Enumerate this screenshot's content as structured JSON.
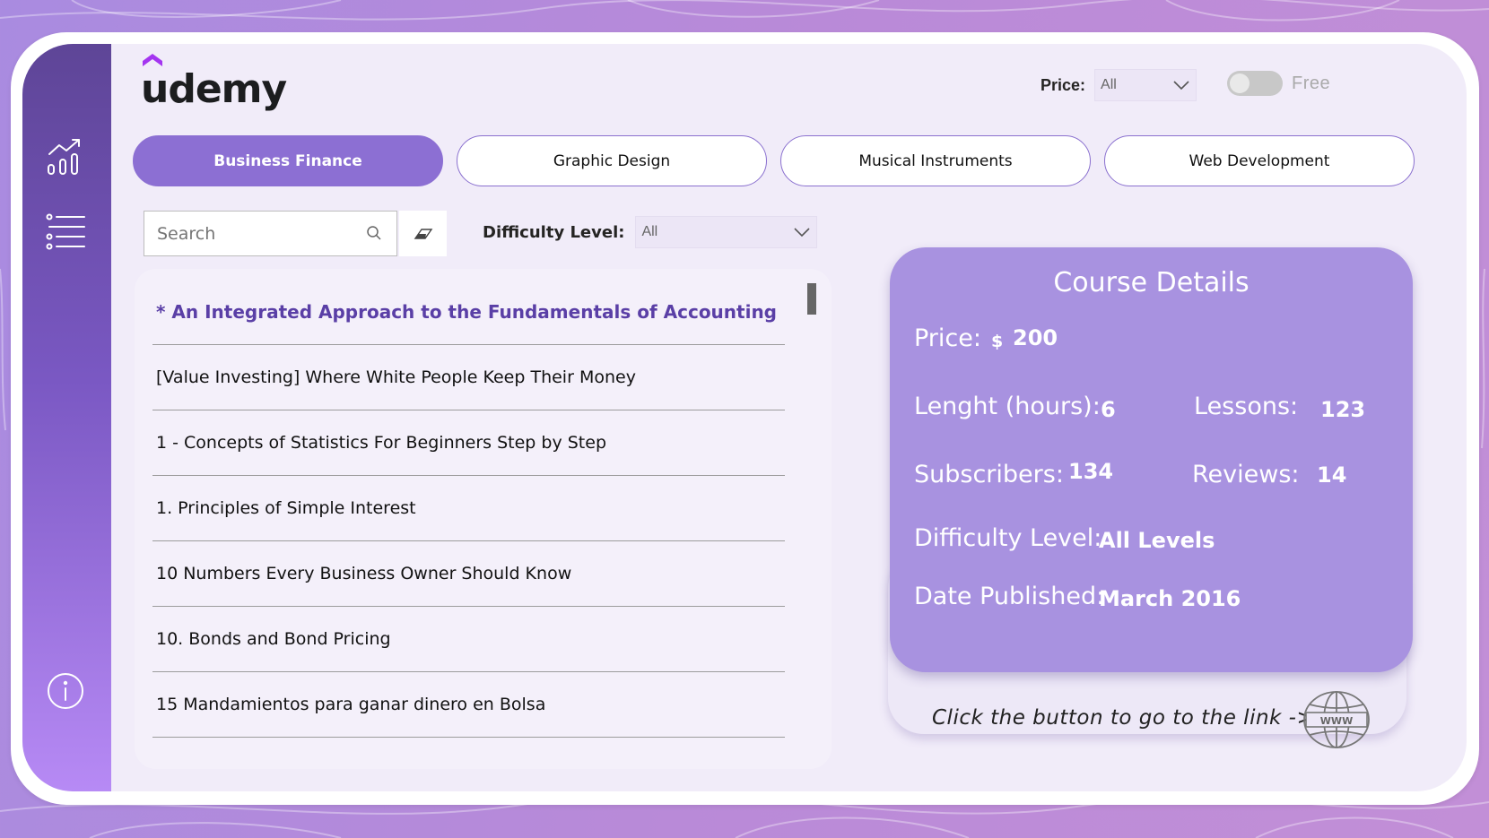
{
  "brand": {
    "logo_text": "udemy"
  },
  "filters": {
    "price_label": "Price:",
    "price_value": "All",
    "free_toggle_label": "Free",
    "free_toggle_on": false,
    "search_placeholder": "Search",
    "difficulty_label": "Difficulty Level:",
    "difficulty_value": "All"
  },
  "tabs": [
    {
      "label": "Business Finance",
      "active": true
    },
    {
      "label": "Graphic Design",
      "active": false
    },
    {
      "label": "Musical Instruments",
      "active": false
    },
    {
      "label": "Web Development",
      "active": false
    }
  ],
  "courses": [
    "* An Integrated Approach to the Fundamentals of Accounting",
    "[Value Investing] Where White People Keep Their Money",
    "1 - Concepts of Statistics For Beginners Step by Step",
    "1. Principles of Simple Interest",
    "10 Numbers Every Business Owner Should Know",
    "10. Bonds and Bond Pricing",
    "15 Mandamientos para ganar dinero en Bolsa"
  ],
  "details": {
    "title": "Course Details",
    "price_label": "Price:",
    "currency": "$",
    "price": "200",
    "length_label": "Lenght (hours):",
    "length": "6",
    "lessons_label": "Lessons:",
    "lessons": "123",
    "subscribers_label": "Subscribers:",
    "subscribers": "134",
    "reviews_label": "Reviews:",
    "reviews": "14",
    "difficulty_label": "Difficulty Level:",
    "difficulty": "All Levels",
    "date_label": "Date Published:",
    "date": "March 2016"
  },
  "cta": {
    "text": "Click the button to go to the link ->",
    "button_icon": "www-globe-icon"
  },
  "sidebar": {
    "icons": [
      "chart-icon",
      "list-icon",
      "info-icon"
    ]
  },
  "colors": {
    "accent": "#8c6fd3",
    "sidebar_top": "#5e4597",
    "details_bg": "#a892e0",
    "page_bg": "#f1ecf9"
  }
}
